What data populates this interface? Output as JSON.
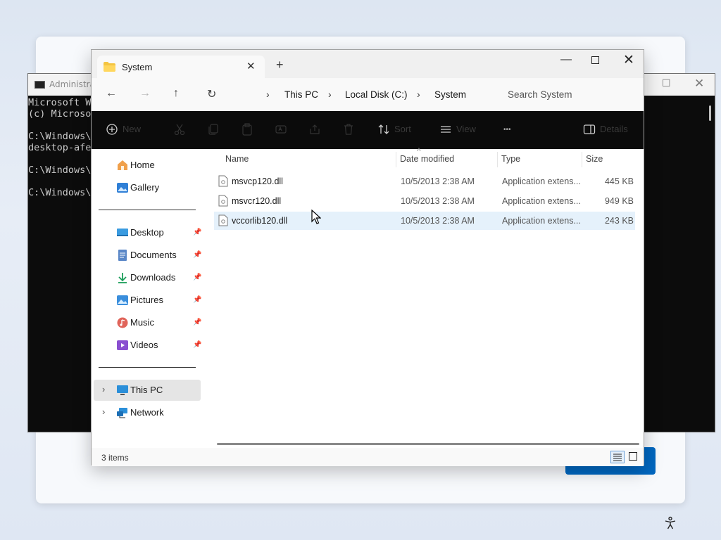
{
  "cmd": {
    "title": "Administrat",
    "lines": [
      "Microsoft Wi",
      "(c) Microso",
      "",
      "C:\\Windows\\S",
      "desktop-afel",
      "",
      "C:\\Windows\\S",
      "",
      "C:\\Windows\\S"
    ]
  },
  "explorer": {
    "tab_title": "System",
    "new_tab_label": "+",
    "breadcrumb": [
      "This PC",
      "Local Disk (C:)",
      "System"
    ],
    "search_placeholder": "Search System",
    "commands": {
      "new": "New",
      "sort": "Sort",
      "view": "View",
      "more": "•••",
      "details": "Details"
    },
    "sidebar": {
      "top": [
        {
          "label": "Home",
          "icon": "home-icon"
        },
        {
          "label": "Gallery",
          "icon": "gallery-icon"
        }
      ],
      "pinned": [
        {
          "label": "Desktop",
          "icon": "desktop-icon"
        },
        {
          "label": "Documents",
          "icon": "documents-icon"
        },
        {
          "label": "Downloads",
          "icon": "downloads-icon"
        },
        {
          "label": "Pictures",
          "icon": "pictures-icon"
        },
        {
          "label": "Music",
          "icon": "music-icon"
        },
        {
          "label": "Videos",
          "icon": "videos-icon"
        }
      ],
      "bottom": [
        {
          "label": "This PC",
          "icon": "this-pc-icon",
          "selected": true
        },
        {
          "label": "Network",
          "icon": "network-icon",
          "selected": false
        }
      ]
    },
    "columns": [
      "Name",
      "Date modified",
      "Type",
      "Size"
    ],
    "files": [
      {
        "name": "msvcp120.dll",
        "date": "10/5/2013 2:38 AM",
        "type": "Application extens...",
        "size": "445 KB",
        "selected": false
      },
      {
        "name": "msvcr120.dll",
        "date": "10/5/2013 2:38 AM",
        "type": "Application extens...",
        "size": "949 KB",
        "selected": false
      },
      {
        "name": "vccorlib120.dll",
        "date": "10/5/2013 2:38 AM",
        "type": "Application extens...",
        "size": "243 KB",
        "selected": true
      }
    ],
    "status": "3 items"
  },
  "colors": {
    "accent": "#0067c0",
    "selection": "#e5f1fb",
    "cmd_bg": "#0c0c0c",
    "command_bar": "#0b0b0b"
  }
}
